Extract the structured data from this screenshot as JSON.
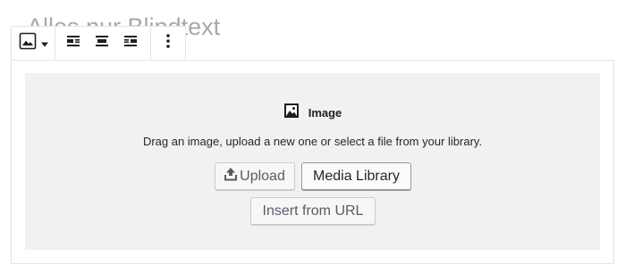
{
  "heading": {
    "text": "Alles nur Blindtext"
  },
  "toolbar": {
    "block_type_icon": "image-icon",
    "block_type_chevron": "chevron-down-icon",
    "align_buttons": [
      {
        "icon": "align-left-icon"
      },
      {
        "icon": "align-center-icon"
      },
      {
        "icon": "align-right-icon"
      }
    ],
    "more_icon": "vertical-ellipsis-icon"
  },
  "placeholder": {
    "label": "Image",
    "label_icon": "image-icon",
    "instructions": "Drag an image, upload a new one or select a file from your library.",
    "upload_label": "Upload",
    "upload_icon": "upload-icon",
    "media_library_label": "Media Library",
    "insert_url_label": "Insert from URL"
  },
  "colors": {
    "heading": "#a8a8a8",
    "placeholder_bg": "#f1f1f1",
    "border": "#e2e4e7",
    "text": "#23282d",
    "button_text": "#555d66"
  }
}
